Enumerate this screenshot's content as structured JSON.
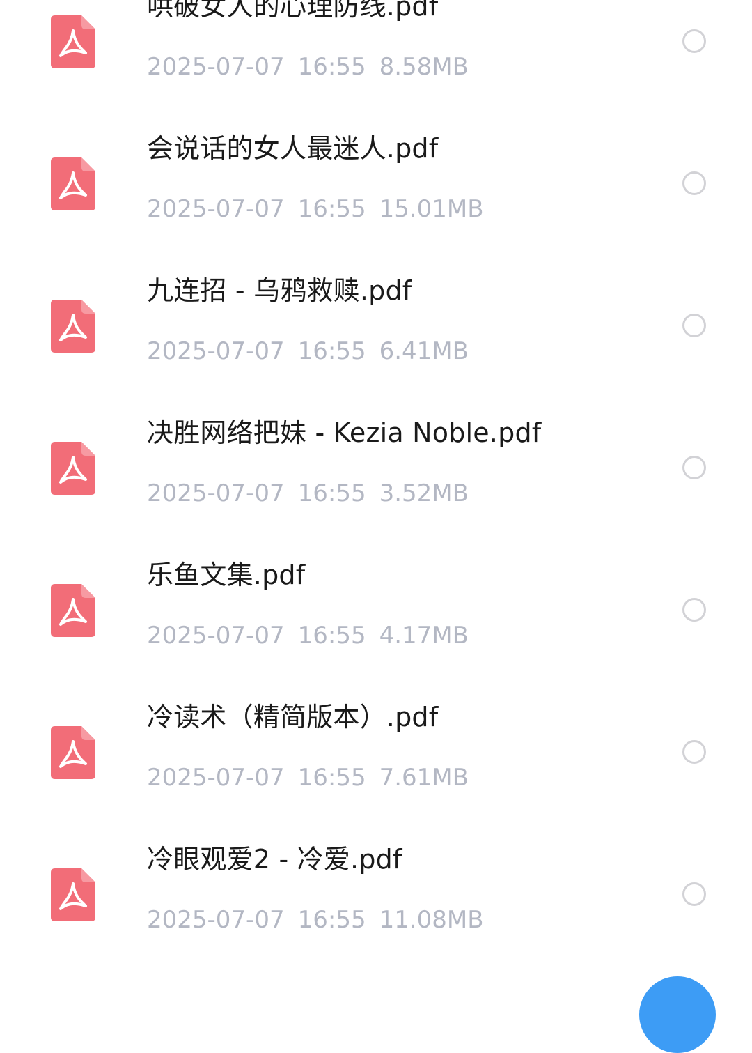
{
  "files": [
    {
      "name": "哄破女人的心理防线.pdf",
      "date": "2025-07-07",
      "time": "16:55",
      "size": "8.58MB",
      "icon": "pdf-icon"
    },
    {
      "name": "会说话的女人最迷人.pdf",
      "date": "2025-07-07",
      "time": "16:55",
      "size": "15.01MB",
      "icon": "pdf-icon"
    },
    {
      "name": "九连招 - 乌鸦救赎.pdf",
      "date": "2025-07-07",
      "time": "16:55",
      "size": "6.41MB",
      "icon": "pdf-icon"
    },
    {
      "name": "决胜网络把妹 - Kezia Noble.pdf",
      "date": "2025-07-07",
      "time": "16:55",
      "size": "3.52MB",
      "icon": "pdf-icon"
    },
    {
      "name": "乐鱼文集.pdf",
      "date": "2025-07-07",
      "time": "16:55",
      "size": "4.17MB",
      "icon": "pdf-icon"
    },
    {
      "name": "冷读术（精简版本）.pdf",
      "date": "2025-07-07",
      "time": "16:55",
      "size": "7.61MB",
      "icon": "pdf-icon"
    },
    {
      "name": "冷眼观爱2 - 冷爱.pdf",
      "date": "2025-07-07",
      "time": "16:55",
      "size": "11.08MB",
      "icon": "pdf-icon"
    }
  ],
  "colors": {
    "pdf_icon": "#f26d78",
    "pdf_icon_fold": "#f79aa2",
    "title_text": "#1a1a1a",
    "meta_text": "#b3b7c3",
    "radio_border": "#d2d2d6",
    "fab": "#3d9cf5"
  }
}
